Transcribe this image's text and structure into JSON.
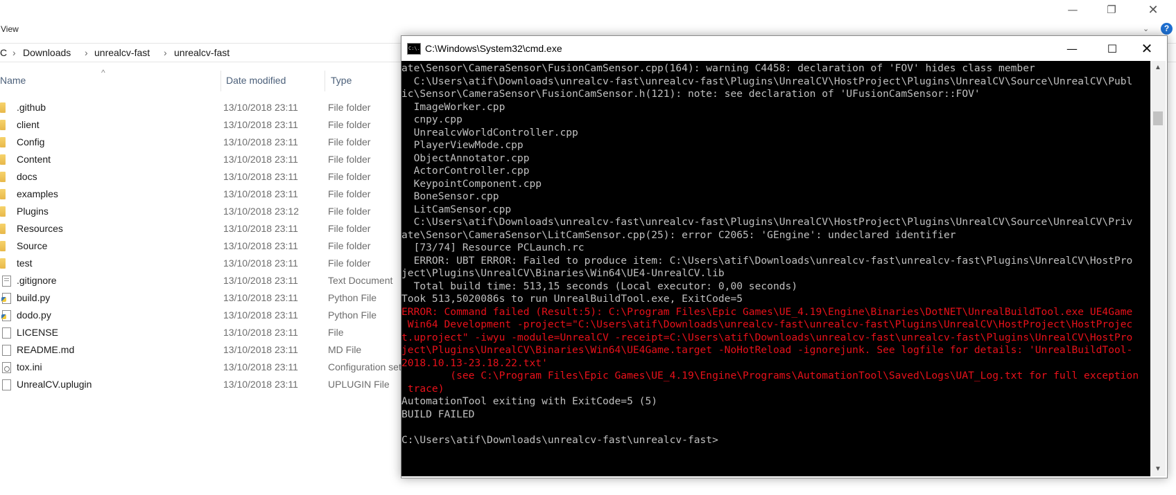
{
  "explorer": {
    "window_controls": {
      "minimize": "—",
      "maximize": "❐",
      "close": "✕"
    },
    "ribbon": {
      "view_tab": "View",
      "expand_glyph": "⌄",
      "help_glyph": "?"
    },
    "breadcrumb": [
      "C",
      "Downloads",
      "unrealcv-fast",
      "unrealcv-fast"
    ],
    "breadcrumb_separator": "›",
    "columns": {
      "name": "Name",
      "date_modified": "Date modified",
      "type": "Type"
    },
    "sort_glyph": "^",
    "files": [
      {
        "name": ".github",
        "date": "13/10/2018 23:11",
        "type": "File folder",
        "icon": "folder"
      },
      {
        "name": "client",
        "date": "13/10/2018 23:11",
        "type": "File folder",
        "icon": "folder"
      },
      {
        "name": "Config",
        "date": "13/10/2018 23:11",
        "type": "File folder",
        "icon": "folder"
      },
      {
        "name": "Content",
        "date": "13/10/2018 23:11",
        "type": "File folder",
        "icon": "folder"
      },
      {
        "name": "docs",
        "date": "13/10/2018 23:11",
        "type": "File folder",
        "icon": "folder"
      },
      {
        "name": "examples",
        "date": "13/10/2018 23:11",
        "type": "File folder",
        "icon": "folder"
      },
      {
        "name": "Plugins",
        "date": "13/10/2018 23:12",
        "type": "File folder",
        "icon": "folder"
      },
      {
        "name": "Resources",
        "date": "13/10/2018 23:11",
        "type": "File folder",
        "icon": "folder"
      },
      {
        "name": "Source",
        "date": "13/10/2018 23:11",
        "type": "File folder",
        "icon": "folder"
      },
      {
        "name": "test",
        "date": "13/10/2018 23:11",
        "type": "File folder",
        "icon": "folder"
      },
      {
        "name": ".gitignore",
        "date": "13/10/2018 23:11",
        "type": "Text Document",
        "icon": "text"
      },
      {
        "name": "build.py",
        "date": "13/10/2018 23:11",
        "type": "Python File",
        "icon": "python"
      },
      {
        "name": "dodo.py",
        "date": "13/10/2018 23:11",
        "type": "Python File",
        "icon": "python"
      },
      {
        "name": "LICENSE",
        "date": "13/10/2018 23:11",
        "type": "File",
        "icon": "file"
      },
      {
        "name": "README.md",
        "date": "13/10/2018 23:11",
        "type": "MD File",
        "icon": "file"
      },
      {
        "name": "tox.ini",
        "date": "13/10/2018 23:11",
        "type": "Configuration settings",
        "icon": "config"
      },
      {
        "name": "UnrealCV.uplugin",
        "date": "13/10/2018 23:11",
        "type": "UPLUGIN File",
        "icon": "file"
      }
    ]
  },
  "cmd": {
    "title": "C:\\Windows\\System32\\cmd.exe",
    "window_controls": {
      "minimize": "—",
      "maximize": "☐",
      "close": "✕"
    },
    "app_icon_text": "C:\\.",
    "scroll_up": "▲",
    "scroll_down": "▼",
    "lines": [
      {
        "text": "ate\\Sensor\\CameraSensor\\FusionCamSensor.cpp(164): warning C4458: declaration of 'FOV' hides class member",
        "error": false
      },
      {
        "text": "  C:\\Users\\atif\\Downloads\\unrealcv-fast\\unrealcv-fast\\Plugins\\UnrealCV\\HostProject\\Plugins\\UnrealCV\\Source\\UnrealCV\\Publ",
        "error": false
      },
      {
        "text": "ic\\Sensor\\CameraSensor\\FusionCamSensor.h(121): note: see declaration of 'UFusionCamSensor::FOV'",
        "error": false
      },
      {
        "text": "  ImageWorker.cpp",
        "error": false
      },
      {
        "text": "  cnpy.cpp",
        "error": false
      },
      {
        "text": "  UnrealcvWorldController.cpp",
        "error": false
      },
      {
        "text": "  PlayerViewMode.cpp",
        "error": false
      },
      {
        "text": "  ObjectAnnotator.cpp",
        "error": false
      },
      {
        "text": "  ActorController.cpp",
        "error": false
      },
      {
        "text": "  KeypointComponent.cpp",
        "error": false
      },
      {
        "text": "  BoneSensor.cpp",
        "error": false
      },
      {
        "text": "  LitCamSensor.cpp",
        "error": false
      },
      {
        "text": "  C:\\Users\\atif\\Downloads\\unrealcv-fast\\unrealcv-fast\\Plugins\\UnrealCV\\HostProject\\Plugins\\UnrealCV\\Source\\UnrealCV\\Priv",
        "error": false
      },
      {
        "text": "ate\\Sensor\\CameraSensor\\LitCamSensor.cpp(25): error C2065: 'GEngine': undeclared identifier",
        "error": false
      },
      {
        "text": "  [73/74] Resource PCLaunch.rc",
        "error": false
      },
      {
        "text": "  ERROR: UBT ERROR: Failed to produce item: C:\\Users\\atif\\Downloads\\unrealcv-fast\\unrealcv-fast\\Plugins\\UnrealCV\\HostPro",
        "error": false
      },
      {
        "text": "ject\\Plugins\\UnrealCV\\Binaries\\Win64\\UE4-UnrealCV.lib",
        "error": false
      },
      {
        "text": "  Total build time: 513,15 seconds (Local executor: 0,00 seconds)",
        "error": false
      },
      {
        "text": "Took 513,5020086s to run UnrealBuildTool.exe, ExitCode=5",
        "error": false
      },
      {
        "text": "ERROR: Command failed (Result:5): C:\\Program Files\\Epic Games\\UE_4.19\\Engine\\Binaries\\DotNET\\UnrealBuildTool.exe UE4Game",
        "error": true
      },
      {
        "text": " Win64 Development -project=\"C:\\Users\\atif\\Downloads\\unrealcv-fast\\unrealcv-fast\\Plugins\\UnrealCV\\HostProject\\HostProjec",
        "error": true
      },
      {
        "text": "t.uproject\" -iwyu -module=UnrealCV -receipt=C:\\Users\\atif\\Downloads\\unrealcv-fast\\unrealcv-fast\\Plugins\\UnrealCV\\HostPro",
        "error": true
      },
      {
        "text": "ject\\Plugins\\UnrealCV\\Binaries\\Win64\\UE4Game.target -NoHotReload -ignorejunk. See logfile for details: 'UnrealBuildTool-",
        "error": true
      },
      {
        "text": "2018.10.13-23.18.22.txt'",
        "error": true
      },
      {
        "text": "        (see C:\\Program Files\\Epic Games\\UE_4.19\\Engine\\Programs\\AutomationTool\\Saved\\Logs\\UAT_Log.txt for full exception",
        "error": true
      },
      {
        "text": " trace)",
        "error": true
      },
      {
        "text": "AutomationTool exiting with ExitCode=5 (5)",
        "error": false
      },
      {
        "text": "BUILD FAILED",
        "error": false
      },
      {
        "text": "",
        "error": false
      },
      {
        "text": "C:\\Users\\atif\\Downloads\\unrealcv-fast\\unrealcv-fast>",
        "error": false
      }
    ]
  }
}
